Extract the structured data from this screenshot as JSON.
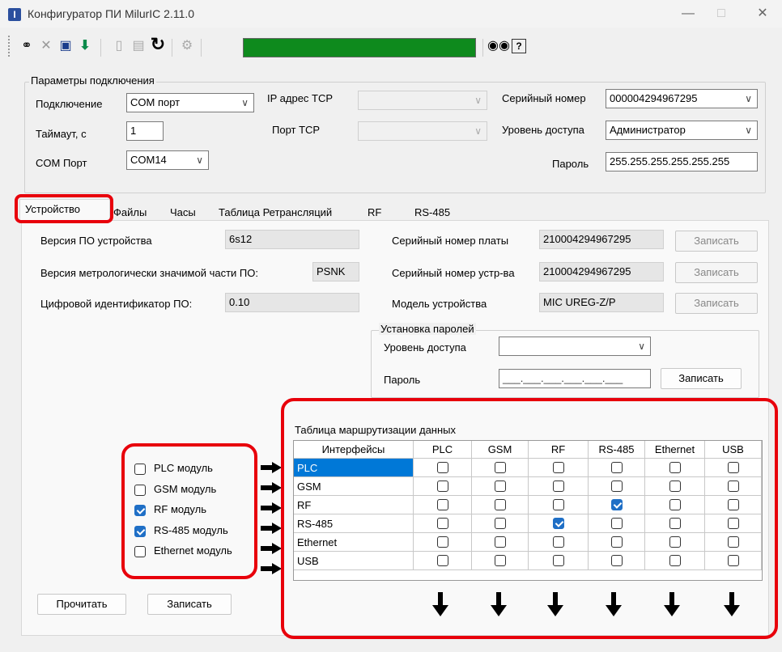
{
  "window": {
    "title": "Конфигуратор ПИ MilurIC 2.11.0"
  },
  "toolbar": {
    "icons": [
      "link-icon",
      "close-icon",
      "save-icon",
      "download-icon",
      "eraser-icon",
      "trash-icon",
      "refresh-icon",
      "settings-icon",
      "binoculars-icon",
      "help-icon"
    ],
    "progress_color": "#0e8a1d"
  },
  "connection": {
    "group_title": "Параметры подключения",
    "connection_label": "Подключение",
    "connection_value": "COM порт",
    "timeout_label": "Таймаут, с",
    "timeout_value": "1",
    "com_label": "COM Порт",
    "com_value": "COM14",
    "ip_label": "IP адрес TCP",
    "port_label": "Порт TCP",
    "serial_label": "Серийный номер",
    "serial_value": "000004294967295",
    "access_label": "Уровень доступа",
    "access_value": "Администратор",
    "password_label": "Пароль",
    "password_value": "255.255.255.255.255.255"
  },
  "tabs": [
    "Устройство",
    "Файлы",
    "Часы",
    "Таблица Ретрансляций",
    "RF",
    "RS-485"
  ],
  "device": {
    "fw_label": "Версия ПО устройства",
    "fw_value": "6s12",
    "metro_label": "Версия метрологически значимой части ПО:",
    "metro_value": "PSNK",
    "digital_label": "Цифровой идентификатор ПО:",
    "digital_value": "0.10",
    "board_serial_label": "Серийный номер платы",
    "board_serial_value": "210004294967295",
    "device_serial_label": "Серийный номер устр-ва",
    "device_serial_value": "210004294967295",
    "model_label": "Модель устройства",
    "model_value": "MIC UREG-Z/P",
    "write_label": "Записать"
  },
  "passwords": {
    "group_title": "Установка паролей",
    "access_label": "Уровень доступа",
    "password_label": "Пароль",
    "password_mask": "___.___.___.___.___.___",
    "write_label": "Записать"
  },
  "modules": [
    {
      "label": "PLC модуль",
      "checked": false
    },
    {
      "label": "GSM модуль",
      "checked": false
    },
    {
      "label": "RF модуль",
      "checked": true
    },
    {
      "label": "RS-485 модуль",
      "checked": true
    },
    {
      "label": "Ethernet модуль",
      "checked": false
    }
  ],
  "routing": {
    "title": "Таблица маршрутизации данных",
    "header": [
      "Интерфейсы",
      "PLC",
      "GSM",
      "RF",
      "RS-485",
      "Ethernet",
      "USB"
    ],
    "rows": [
      {
        "name": "PLC",
        "checks": [
          false,
          false,
          false,
          false,
          false,
          false
        ]
      },
      {
        "name": "GSM",
        "checks": [
          false,
          false,
          false,
          false,
          false,
          false
        ]
      },
      {
        "name": "RF",
        "checks": [
          false,
          false,
          false,
          true,
          false,
          false
        ]
      },
      {
        "name": "RS-485",
        "checks": [
          false,
          false,
          true,
          false,
          false,
          false
        ]
      },
      {
        "name": "Ethernet",
        "checks": [
          false,
          false,
          false,
          false,
          false,
          false
        ]
      },
      {
        "name": "USB",
        "checks": [
          false,
          false,
          false,
          false,
          false,
          false
        ]
      }
    ]
  },
  "actions": {
    "read_label": "Прочитать",
    "write_label": "Записать"
  },
  "colors": {
    "highlight": "#e8000b",
    "selected_row": "#0078d7",
    "check": "#1f6fc6"
  }
}
